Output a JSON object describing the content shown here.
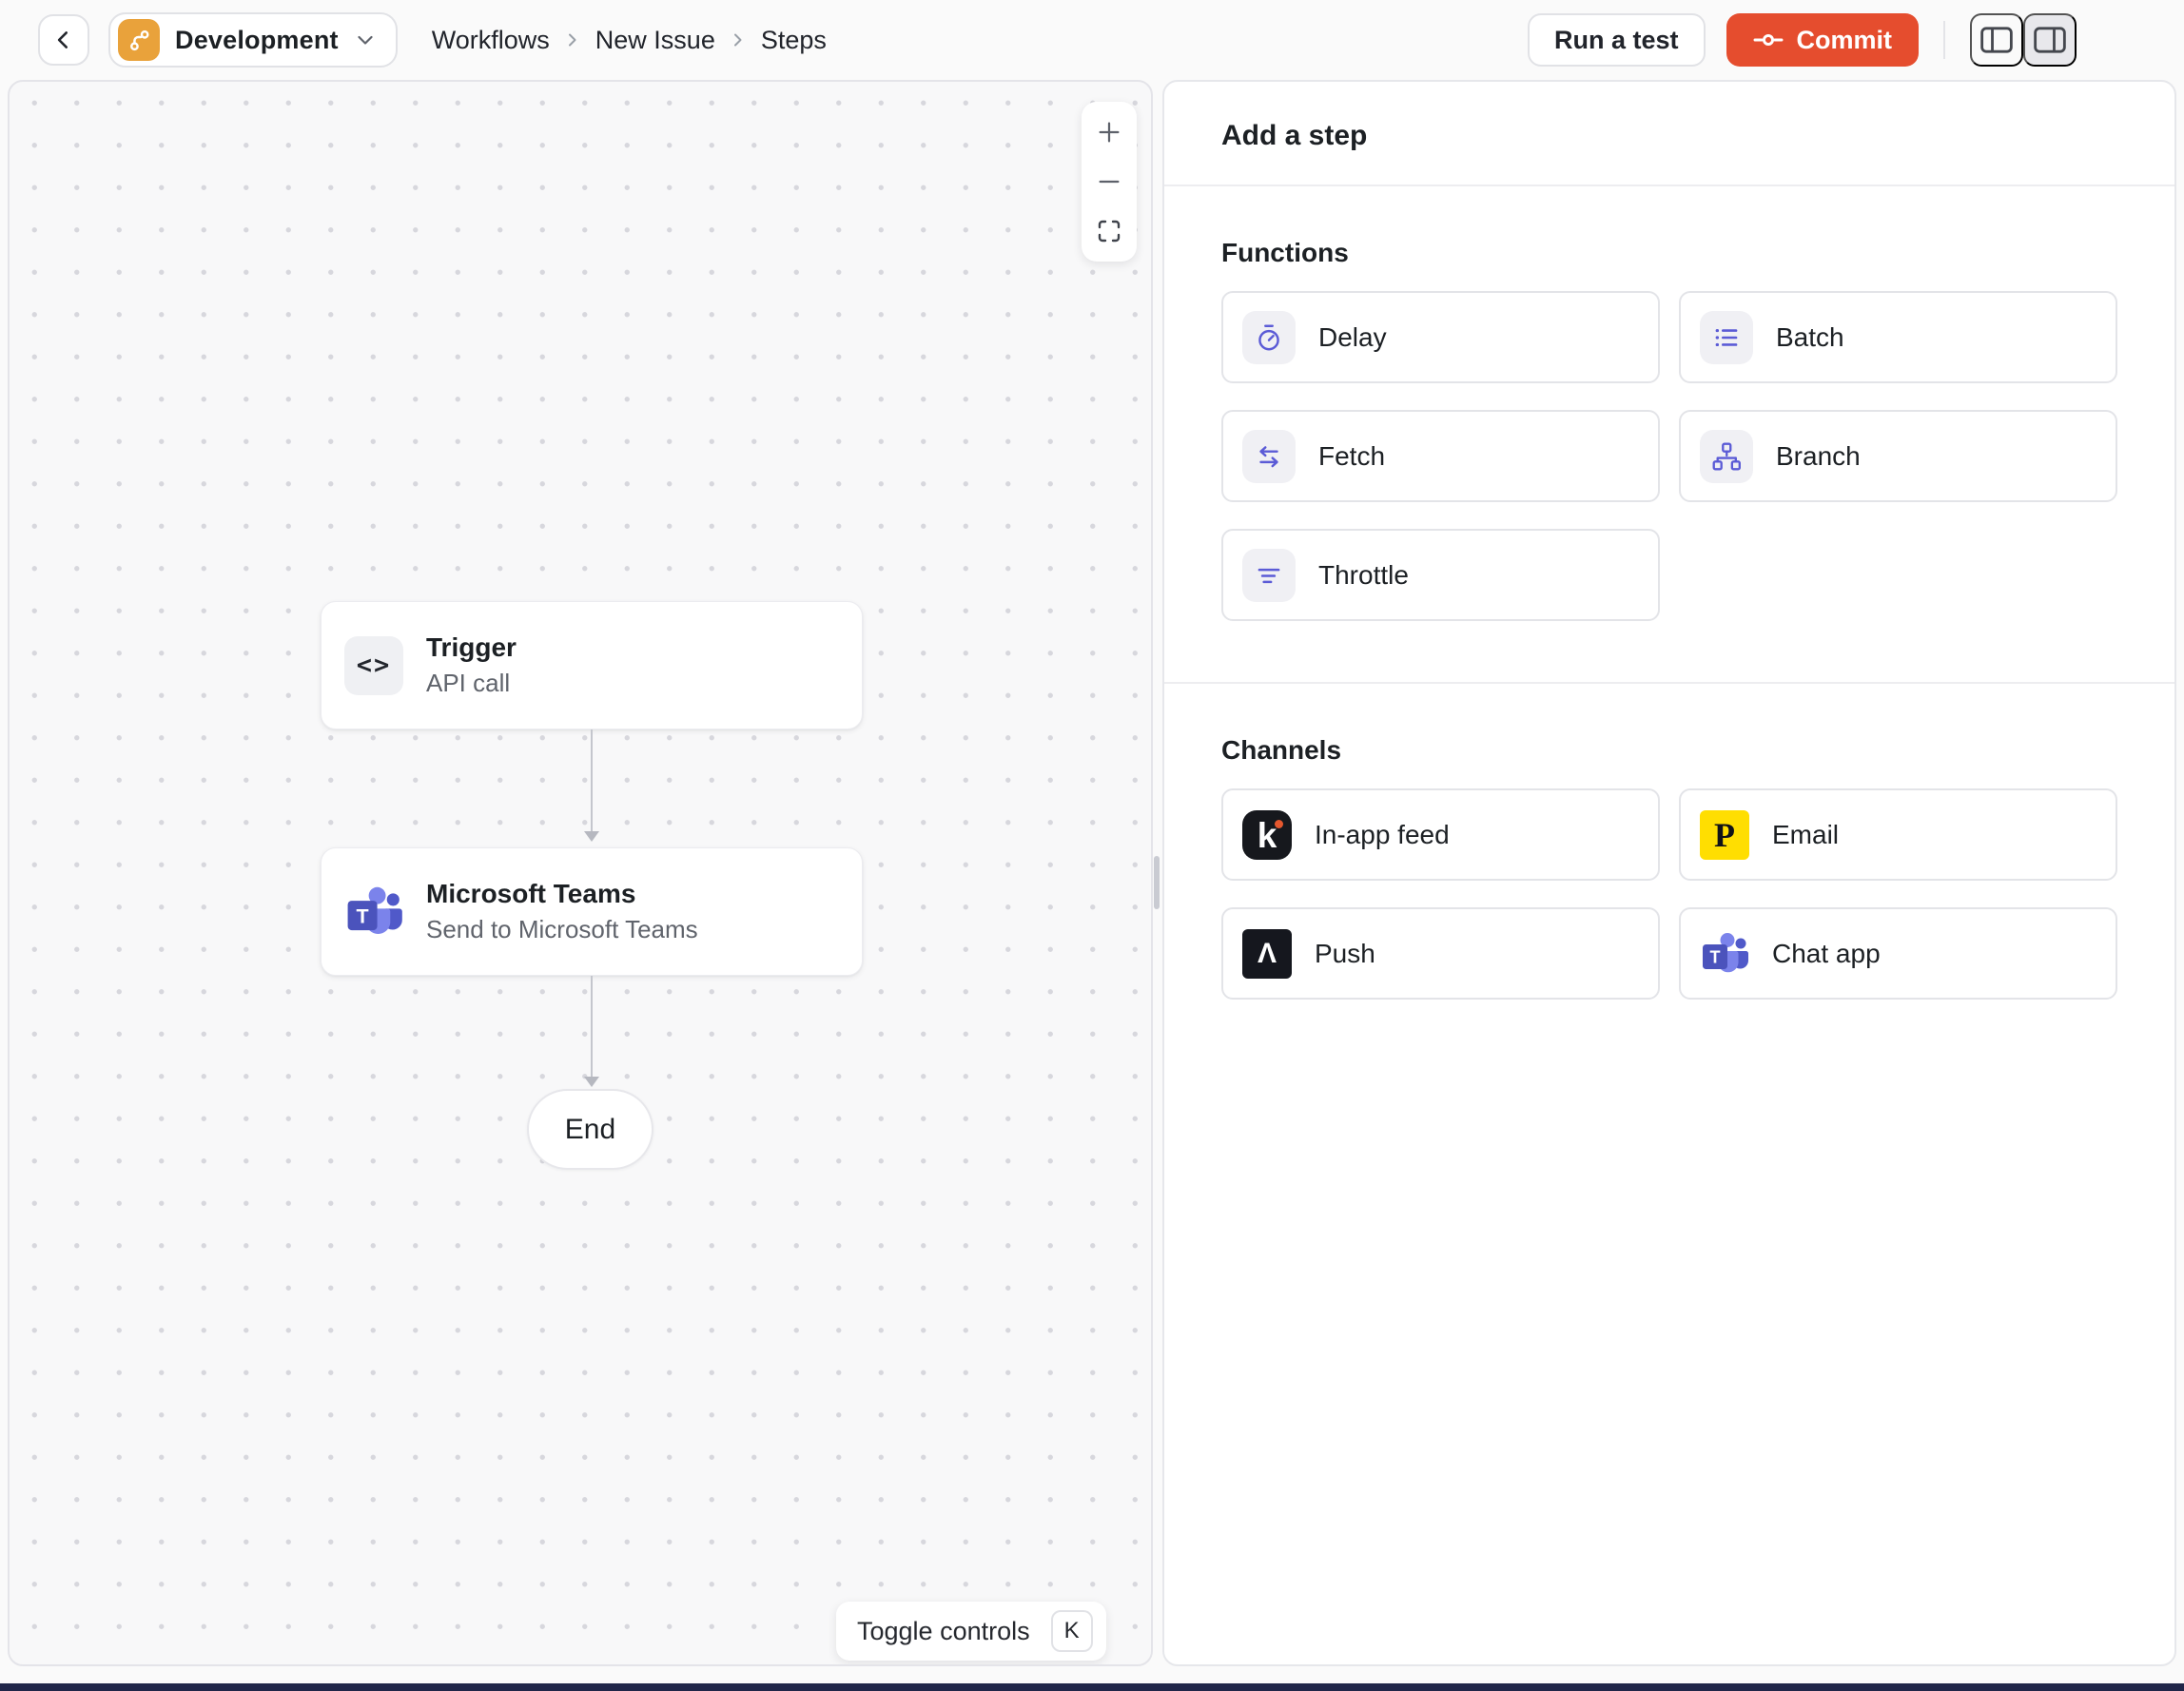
{
  "topbar": {
    "environment": {
      "label": "Development"
    },
    "breadcrumb": {
      "items": [
        "Workflows",
        "New Issue",
        "Steps"
      ]
    },
    "actions": {
      "run_test": "Run a test",
      "commit": "Commit"
    }
  },
  "canvas": {
    "trigger_node": {
      "title": "Trigger",
      "subtitle": "API call",
      "icon_glyph": "<>"
    },
    "teams_node": {
      "title": "Microsoft Teams",
      "subtitle": "Send to Microsoft Teams",
      "icon_glyph": "T"
    },
    "end_node": {
      "label": "End"
    },
    "zoom": {
      "zoom_in": "+",
      "zoom_out": "−"
    },
    "toggle_controls": {
      "label": "Toggle controls",
      "shortcut": "K"
    }
  },
  "panel": {
    "title": "Add a step",
    "functions": {
      "label": "Functions",
      "items": [
        {
          "label": "Delay"
        },
        {
          "label": "Batch"
        },
        {
          "label": "Fetch"
        },
        {
          "label": "Branch"
        },
        {
          "label": "Throttle"
        }
      ]
    },
    "channels": {
      "label": "Channels",
      "items": [
        {
          "label": "In-app feed",
          "glyph": "k"
        },
        {
          "label": "Email",
          "glyph": "P"
        },
        {
          "label": "Push",
          "glyph": "Λ"
        },
        {
          "label": "Chat app",
          "glyph": "T"
        }
      ]
    }
  },
  "colors": {
    "commit": "#E54D2E",
    "amber": "#E9A23B",
    "indigo": "#5B5BD6",
    "knock_bg": "#16181D",
    "knock_dot": "#E4572E",
    "postmark_bg": "#FFDE01",
    "push_bg": "#15171E",
    "teams_dark": "#4B53BC",
    "teams_mid": "#5059C9",
    "teams_light": "#7B83EB",
    "bottom_strip": "#202649"
  }
}
